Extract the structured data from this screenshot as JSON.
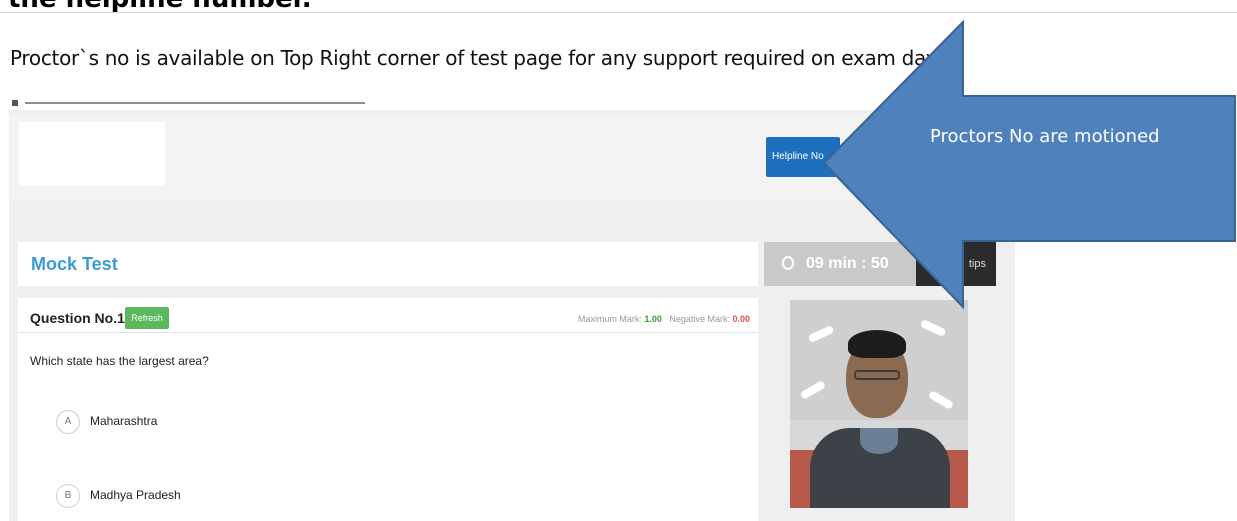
{
  "heading": "the helpline number.",
  "instruction": "Proctor`s no is available on Top Right corner of test page for any support required on exam day.",
  "screenshot": {
    "helpline_button": "Helpline No",
    "test_title": "Mock Test",
    "timer": "09 min : 50 sec",
    "tips_button": "tips",
    "question": {
      "number_label": "Question No.1",
      "refresh_label": "Refresh",
      "max_mark_label": "Maximum Mark:",
      "max_mark_value": "1.00",
      "neg_mark_label": "Negative Mark:",
      "neg_mark_value": "0.00",
      "text": "Which state has the largest area?",
      "options": [
        {
          "letter": "A",
          "label": "Maharashtra"
        },
        {
          "letter": "B",
          "label": "Madhya Pradesh"
        }
      ]
    }
  },
  "callout": {
    "text": "Proctors No are motioned",
    "color": "#4f81bd"
  }
}
